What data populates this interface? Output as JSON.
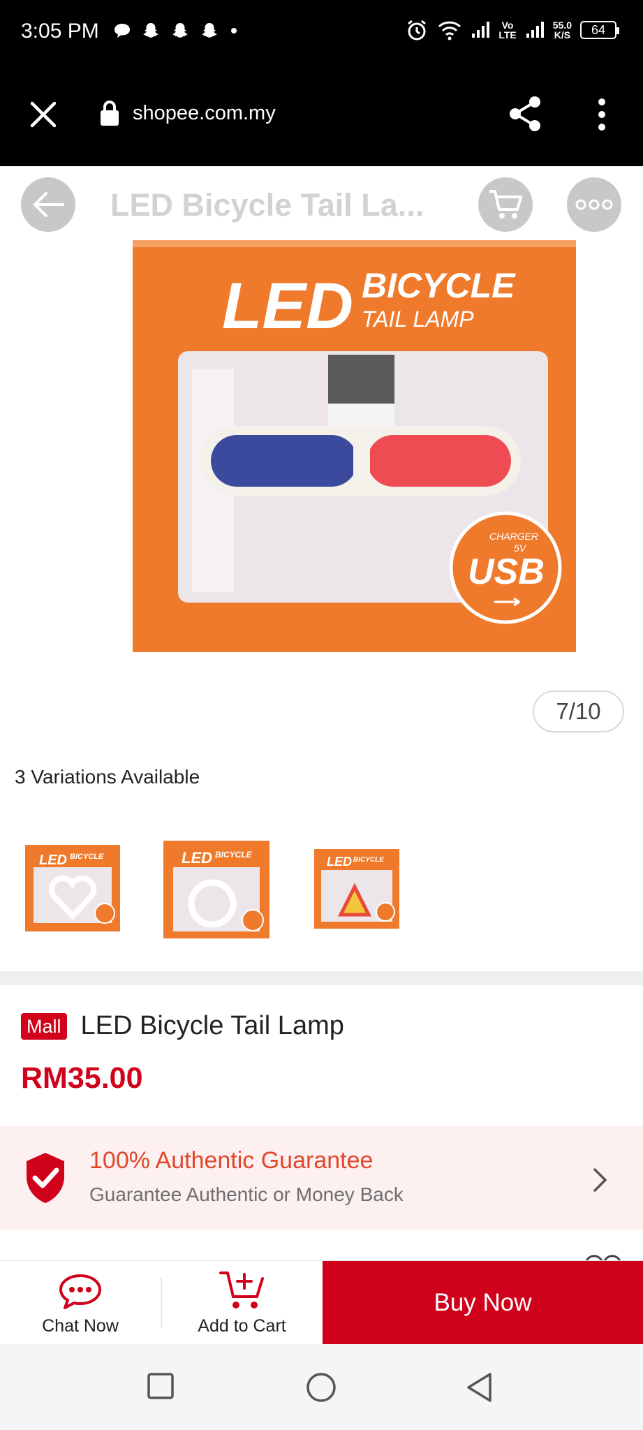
{
  "status_bar": {
    "time": "3:05 PM",
    "network_speed_value": "55.0",
    "network_speed_unit": "K/S",
    "volte_top": "Vo",
    "volte_bottom": "LTE",
    "battery": "64"
  },
  "browser": {
    "url": "shopee.com.my"
  },
  "header": {
    "title": "LED Bicycle Tail La..."
  },
  "gallery": {
    "pager": "7/10",
    "image_text_main": "LED",
    "image_text_sub1": "BICYCLE",
    "image_text_sub2": "TAIL LAMP",
    "usb_top": "CHARGER",
    "usb_top2": "5V",
    "usb_main": "USB"
  },
  "variations": {
    "label": "3 Variations Available",
    "items": [
      {
        "shape": "heart",
        "label_main": "LED",
        "label_sub": "BICYCLE"
      },
      {
        "shape": "ring",
        "label_main": "LED",
        "label_sub": "BICYCLE"
      },
      {
        "shape": "triangle",
        "label_main": "LED",
        "label_sub": "BICYCLE"
      }
    ]
  },
  "product": {
    "badge": "Mall",
    "title": "LED Bicycle Tail Lamp",
    "price": "RM35.00"
  },
  "guarantee": {
    "title": "100% Authentic Guarantee",
    "subtitle": "Guarantee Authentic or Money Back"
  },
  "actions": {
    "chat_label": "Chat Now",
    "cart_label": "Add to Cart",
    "buy_label": "Buy Now"
  },
  "colors": {
    "brand_red": "#d0011b",
    "guarantee_orange": "#e0472b",
    "box_orange": "#f07a2c"
  }
}
